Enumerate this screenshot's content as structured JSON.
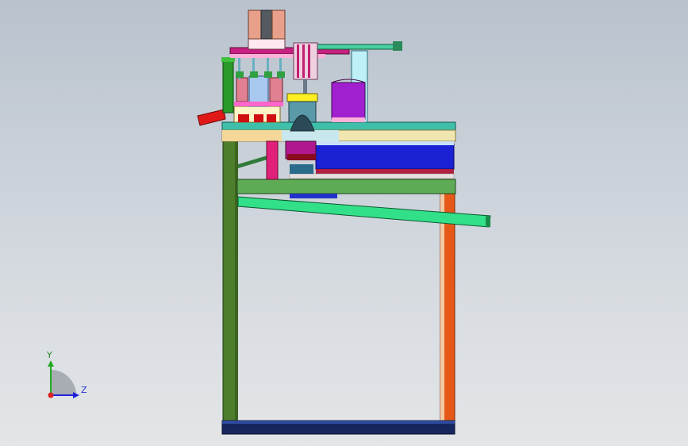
{
  "viewport": {
    "background_top": "#b9c2cd",
    "background_bottom": "#e3e5e7"
  },
  "triad": {
    "y_label": "Y",
    "z_label": "Z",
    "y_color": "#22aa22",
    "z_color": "#2222dd",
    "origin_color": "#dd2222"
  },
  "model": {
    "frame_color_left": "#4a7a2a",
    "frame_color_right": "#e0541a",
    "table_top_color": "#3fbfaa",
    "blue_panel_color": "#1a22d4",
    "slide_rail_color": "#33e08a",
    "base_color": "#1a2a66"
  }
}
